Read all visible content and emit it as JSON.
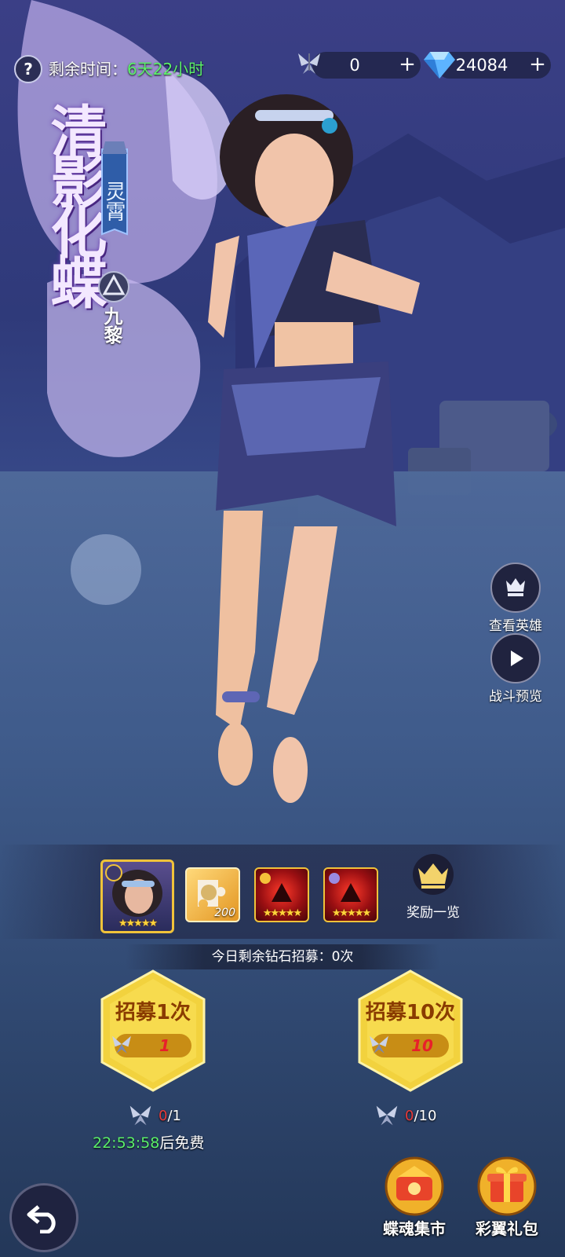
{
  "top_bar": {
    "help_symbol": "?",
    "time_label": "剩余时间：",
    "time_value": "6天22小时",
    "token_value": "0",
    "diamond_value": "24084",
    "plus_symbol": "+"
  },
  "hero": {
    "title": "清影化蝶",
    "faction": "灵霄",
    "class_name": "九黎"
  },
  "side_buttons": {
    "view_hero": "查看英雄",
    "battle_preview": "战斗预览"
  },
  "rewards": {
    "items": [
      {
        "name": "hero-portrait",
        "stars": "★★★★★"
      },
      {
        "name": "puzzle-fragment",
        "count": "200"
      },
      {
        "name": "red-hero-card-1",
        "stars": "★★★★★"
      },
      {
        "name": "red-hero-card-2",
        "stars": "★★★★★"
      }
    ],
    "list_label": "奖励一览",
    "today_remaining": "今日剩余钻石招募：0次"
  },
  "recruit": {
    "single": {
      "label": "招募1次",
      "cost": "1",
      "owned": "0",
      "required": "/1"
    },
    "ten": {
      "label": "招募10次",
      "cost": "10",
      "owned": "0",
      "required": "/10"
    },
    "free_timer": "22:53:58",
    "free_suffix": "后免费"
  },
  "bottom": {
    "market_label": "蝶魂集市",
    "gift_label": "彩翼礼包"
  },
  "colors": {
    "accent_green": "#5bf06a",
    "gold": "#f7d33a",
    "red_text": "#e8202a"
  }
}
